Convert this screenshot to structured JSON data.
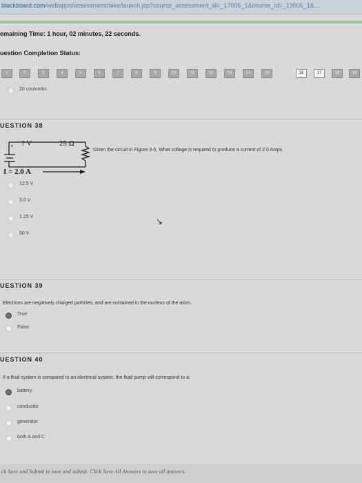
{
  "browser": {
    "host": "blackboard.com",
    "path": "/webapps/assessment/take/launch.jsp?course_assessment_id=_17005_1&course_id=_19005_1&..."
  },
  "status": {
    "time_label": "emaining Time:",
    "time_value": "1 hour, 02 minutes, 22 seconds.",
    "completion_label": "uestion Completion Status:"
  },
  "question_nav": [
    "1",
    "2",
    "3",
    "4",
    "5",
    "6",
    "7",
    "8",
    "9",
    "10",
    "11",
    "12",
    "13",
    "14",
    "15",
    "16",
    "17",
    "18",
    "19"
  ],
  "prev_answer": "20 coulombs",
  "q38": {
    "heading": "UESTION 38",
    "text": "Given the circuit in Figure 3-5, What voltage is required to produce a current of 2.0 Amps",
    "circuit": {
      "voltage": "? V",
      "resistance": "25 Ω",
      "current": "I = 2.0 A"
    },
    "options": [
      "12.5 V",
      "5.0 V",
      "1.25 V",
      "50 V"
    ]
  },
  "q39": {
    "heading": "UESTION 39",
    "text": "Electrons are negatively charged particles, and are contained in the nucleus of the atom.",
    "options": [
      "True",
      "False"
    ]
  },
  "q40": {
    "heading": "UESTION 40",
    "text": "If a fluid system is compared to an electrical system, the fluid pump will correspond to a:",
    "options": [
      "battery",
      "conductor",
      "generator",
      "both A and C"
    ]
  },
  "footer": {
    "text": "ck Save and Submit to save and submit. Click Save All Answers to save all answers."
  }
}
